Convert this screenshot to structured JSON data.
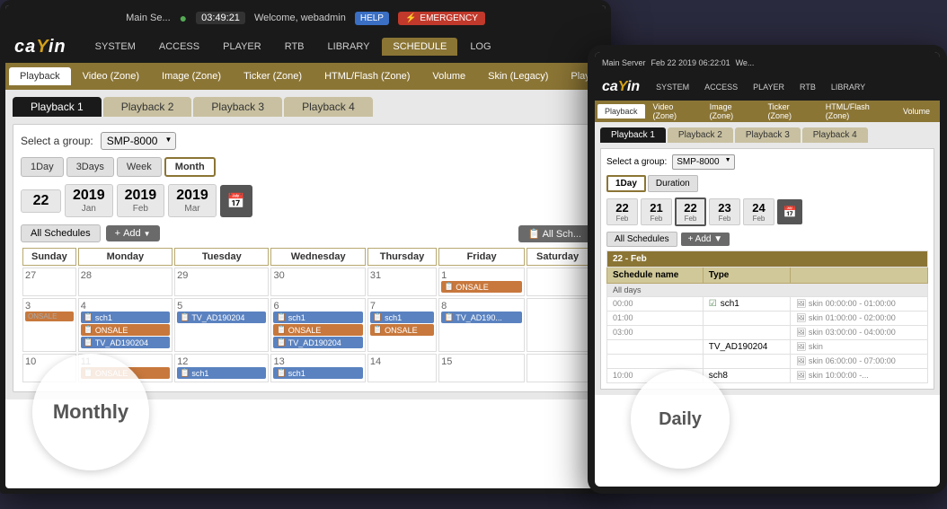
{
  "scene": {
    "laptop": {
      "topBar": {
        "server": "Main Se...",
        "time": "03:49:21",
        "welcome": "Welcome, webadmin",
        "help": "HELP",
        "emergency": "EMERGENCY"
      },
      "logo": "ca/in",
      "mainNav": [
        {
          "label": "SYSTEM",
          "active": false
        },
        {
          "label": "ACCESS",
          "active": false
        },
        {
          "label": "PLAYER",
          "active": false
        },
        {
          "label": "RTB",
          "active": false
        },
        {
          "label": "LIBRARY",
          "active": false
        },
        {
          "label": "SCHEDULE",
          "active": true
        },
        {
          "label": "LOG",
          "active": false
        }
      ],
      "subNav": [
        {
          "label": "Playback",
          "active": true
        },
        {
          "label": "Video (Zone)",
          "active": false
        },
        {
          "label": "Image (Zone)",
          "active": false
        },
        {
          "label": "Ticker (Zone)",
          "active": false
        },
        {
          "label": "HTML/Flash (Zone)",
          "active": false
        },
        {
          "label": "Volume",
          "active": false
        },
        {
          "label": "Skin (Legacy)",
          "active": false
        },
        {
          "label": "Playlist (Legacy)",
          "active": false
        }
      ],
      "playbackTabs": [
        {
          "label": "Playback 1",
          "active": true
        },
        {
          "label": "Playback 2",
          "active": false
        },
        {
          "label": "Playback 3",
          "active": false
        },
        {
          "label": "Playback 4",
          "active": false
        }
      ],
      "groupSelect": {
        "label": "Select a group:",
        "value": "SMP-8000"
      },
      "viewButtons": [
        "1Day",
        "3Days",
        "Week",
        "Month"
      ],
      "activeView": "Month",
      "dates": [
        {
          "num": "22",
          "label": ""
        },
        {
          "num": "2019",
          "label": "Jan"
        },
        {
          "num": "2019",
          "label": "Feb"
        },
        {
          "num": "2019",
          "label": "Mar"
        }
      ],
      "calendarHeaders": [
        "Sunday",
        "Monday",
        "Tuesday",
        "Wednesday",
        "Thursday",
        "Friday",
        "Saturday"
      ],
      "calendarRows": [
        [
          {
            "day": "27",
            "events": []
          },
          {
            "day": "28",
            "events": []
          },
          {
            "day": "29",
            "events": []
          },
          {
            "day": "30",
            "events": []
          },
          {
            "day": "31",
            "events": []
          },
          {
            "day": "1",
            "events": [
              {
                "label": "ONSALE",
                "color": "orange"
              }
            ]
          },
          {
            "day": "",
            "events": []
          }
        ],
        [
          {
            "day": "3",
            "events": [
              {
                "label": "ONSALE",
                "color": "orange"
              }
            ]
          },
          {
            "day": "4",
            "events": [
              {
                "label": "sch1",
                "color": "blue"
              },
              {
                "label": "ONSALE",
                "color": "orange"
              },
              {
                "label": "TV_AD190204",
                "color": "blue"
              }
            ]
          },
          {
            "day": "5",
            "events": [
              {
                "label": "TV_AD190204",
                "color": "blue"
              }
            ]
          },
          {
            "day": "6",
            "events": [
              {
                "label": "sch1",
                "color": "blue"
              },
              {
                "label": "ONSALE",
                "color": "orange"
              },
              {
                "label": "TV_AD190204",
                "color": "blue"
              }
            ]
          },
          {
            "day": "7",
            "events": [
              {
                "label": "sch1",
                "color": "blue"
              },
              {
                "label": "ONSALE",
                "color": "orange"
              }
            ]
          },
          {
            "day": "8",
            "events": [
              {
                "label": "TV_AD190...",
                "color": "blue"
              }
            ]
          },
          {
            "day": "",
            "events": []
          }
        ],
        [
          {
            "day": "10",
            "events": []
          },
          {
            "day": "11",
            "events": [
              {
                "label": "ONSALE",
                "color": "orange"
              }
            ]
          },
          {
            "day": "12",
            "events": [
              {
                "label": "sch1",
                "color": "blue"
              }
            ]
          },
          {
            "day": "13",
            "events": [
              {
                "label": "sch1",
                "color": "blue"
              }
            ]
          },
          {
            "day": "14",
            "events": []
          },
          {
            "day": "15",
            "events": []
          },
          {
            "day": "",
            "events": []
          }
        ]
      ],
      "circleLabel": "Monthly"
    },
    "tablet": {
      "topBar": {
        "server": "Main Server",
        "date": "Feb 22 2019 06:22:01",
        "welcome": "We..."
      },
      "mainNav": [
        {
          "label": "SYSTEM",
          "active": false
        },
        {
          "label": "ACCESS",
          "active": false
        },
        {
          "label": "PLAYER",
          "active": false
        },
        {
          "label": "RTB",
          "active": false
        },
        {
          "label": "LIBRARY",
          "active": false
        }
      ],
      "subNav": [
        {
          "label": "Playback",
          "active": true
        },
        {
          "label": "Video (Zone)",
          "active": false
        },
        {
          "label": "Image (Zone)",
          "active": false
        },
        {
          "label": "Ticker (Zone)",
          "active": false
        },
        {
          "label": "HTML/Flash (Zone)",
          "active": false
        },
        {
          "label": "Volume",
          "active": false
        }
      ],
      "playbackTabs": [
        {
          "label": "Playback 1",
          "active": true
        },
        {
          "label": "Playback 2",
          "active": false
        },
        {
          "label": "Playback 3",
          "active": false
        },
        {
          "label": "Playback 4",
          "active": false
        }
      ],
      "groupSelect": {
        "label": "Select a group:",
        "value": "SMP-8000"
      },
      "viewButtons": [
        "1Day",
        "Duration"
      ],
      "activeView": "1Day",
      "dates": [
        {
          "num": "22",
          "label": "Feb"
        },
        {
          "num": "21",
          "label": "Feb"
        },
        {
          "num": "22",
          "label": "Feb",
          "highlighted": true
        },
        {
          "num": "23",
          "label": "Feb"
        },
        {
          "num": "24",
          "label": "Feb"
        }
      ],
      "scheduleHeader": "22 - Feb",
      "scheduleColumns": [
        "Schedule name",
        "Type",
        ""
      ],
      "scheduleRows": [
        {
          "section": "All days",
          "time": "",
          "name": "",
          "type": "",
          "timeRange": ""
        },
        {
          "section": "",
          "time": "00:00",
          "name": "sch1",
          "checked": true,
          "type": "skin",
          "timeRange": "00:00:00 - 01:00:00"
        },
        {
          "section": "",
          "time": "01:00",
          "name": "",
          "checked": false,
          "type": "skin",
          "timeRange": "01:00:00 - 02:00:00"
        },
        {
          "section": "",
          "time": "03:00",
          "name": "",
          "checked": false,
          "type": "skin",
          "timeRange": "03:00:00 - 04:00:00"
        },
        {
          "section": "",
          "time": "",
          "name": "TV_AD190204",
          "checked": false,
          "type": "skin",
          "timeRange": ""
        },
        {
          "section": "",
          "time": "",
          "name": "",
          "checked": false,
          "type": "skin",
          "timeRange": "06:00:00 - 07:00:00"
        },
        {
          "section": "",
          "time": "10:00",
          "name": "sch8",
          "checked": false,
          "type": "skin",
          "timeRange": "10:00:00 - ..."
        }
      ],
      "circleLabel": "Daily"
    }
  }
}
